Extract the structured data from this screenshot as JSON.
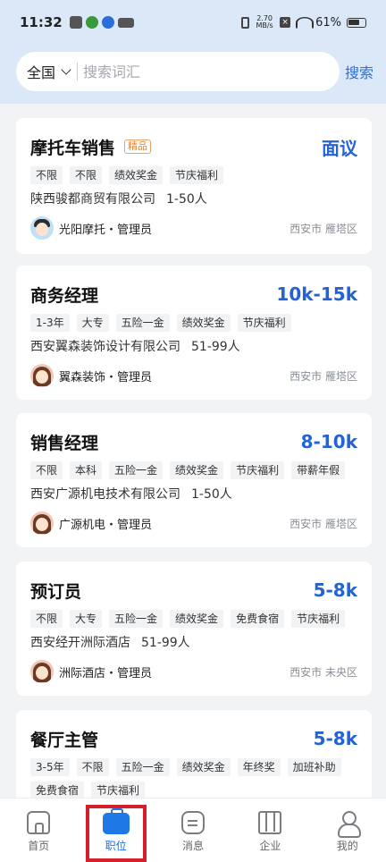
{
  "status_bar": {
    "time": "11:32",
    "net_speed_value": "2.70",
    "net_speed_unit": "MB/s",
    "battery": "61%"
  },
  "search": {
    "scope": "全国",
    "placeholder": "搜索词汇",
    "button": "搜索"
  },
  "jobs": [
    {
      "title": "摩托车销售",
      "badge": "精品",
      "salary": "面议",
      "tags": [
        "不限",
        "不限",
        "绩效奖金",
        "节庆福利"
      ],
      "company": "陕西骏都商贸有限公司",
      "size": "1-50人",
      "recruiter": "光阳摩托・管理员",
      "location": "西安市 雁塔区",
      "avatar": "boy"
    },
    {
      "title": "商务经理",
      "badge": "",
      "salary": "10k-15k",
      "tags": [
        "1-3年",
        "大专",
        "五险一金",
        "绩效奖金",
        "节庆福利"
      ],
      "company": "西安翼森装饰设计有限公司",
      "size": "51-99人",
      "recruiter": "翼森装饰・管理员",
      "location": "西安市 雁塔区",
      "avatar": "girl"
    },
    {
      "title": "销售经理",
      "badge": "",
      "salary": "8-10k",
      "tags": [
        "不限",
        "本科",
        "五险一金",
        "绩效奖金",
        "节庆福利",
        "带薪年假"
      ],
      "company": "西安广源机电技术有限公司",
      "size": "1-50人",
      "recruiter": "广源机电・管理员",
      "location": "西安市 雁塔区",
      "avatar": "girl"
    },
    {
      "title": "预订员",
      "badge": "",
      "salary": "5-8k",
      "tags": [
        "不限",
        "大专",
        "五险一金",
        "绩效奖金",
        "免费食宿",
        "节庆福利"
      ],
      "company": "西安经开洲际酒店",
      "size": "51-99人",
      "recruiter": "洲际酒店・管理员",
      "location": "西安市 未央区",
      "avatar": "girl"
    },
    {
      "title": "餐厅主管",
      "badge": "",
      "salary": "5-8k",
      "tags": [
        "3-5年",
        "不限",
        "五险一金",
        "绩效奖金",
        "年终奖",
        "加班补助",
        "免费食宿",
        "节庆福利"
      ],
      "company": "",
      "size": "",
      "recruiter": "",
      "location": "",
      "avatar": ""
    }
  ],
  "nav": [
    {
      "label": "首页",
      "icon": "home-icon"
    },
    {
      "label": "职位",
      "icon": "briefcase-icon",
      "active": true
    },
    {
      "label": "消息",
      "icon": "message-icon"
    },
    {
      "label": "企业",
      "icon": "company-map-icon"
    },
    {
      "label": "我的",
      "icon": "profile-icon"
    }
  ],
  "colors": {
    "accent": "#2363d6",
    "header_bg": "#dbe8f8",
    "badge": "#e8822b",
    "highlight_frame": "#d4202a"
  }
}
